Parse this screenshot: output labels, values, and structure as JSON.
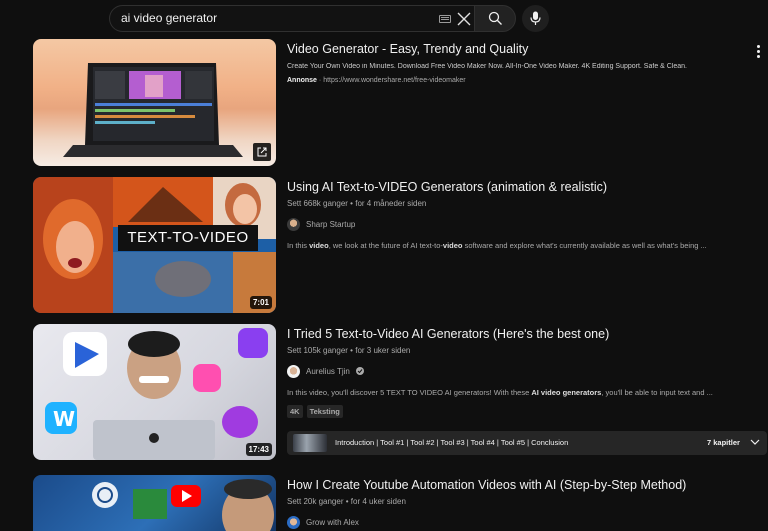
{
  "search": {
    "query": "ai video generator"
  },
  "results": [
    {
      "title": "Video Generator - Easy, Trendy and Quality",
      "description": "Create Your Own Video in Minutes. Download Free Video Maker Now. All-In-One Video Maker. 4K Editing Support. Safe & Clean.",
      "sponsor_label": "Annonse",
      "sponsor_sep": "·",
      "sponsor_url": "https://www.wondershare.net/free-videomaker"
    },
    {
      "title": "Using AI Text-to-VIDEO Generators (animation & realistic)",
      "views": "Sett 668k ganger",
      "age": "for 4 måneder siden",
      "channel": "Sharp Startup",
      "duration": "7:01",
      "thumb_text": "TEXT-TO-VIDEO",
      "desc_a": "In this ",
      "desc_b": "video",
      "desc_c": ", we look at the future of AI text-to-",
      "desc_d": "video",
      "desc_e": " software and explore what's currently available as well as what's being ..."
    },
    {
      "title": "I Tried 5 Text-to-Video AI Generators (Here's the best one)",
      "views": "Sett 105k ganger",
      "age": "for 3 uker siden",
      "channel": "Aurelius Tjin",
      "duration": "17:43",
      "desc_a": "In this video, you'll discover 5 TEXT TO VIDEO AI generators! With these ",
      "desc_b": "AI video generators",
      "desc_c": ", you'll be able to input text and ...",
      "badges": [
        "4K",
        "Teksting"
      ],
      "chapters_text": "Introduction | Tool #1 | Tool #2 | Tool #3 | Tool #4 | Tool #5 | Conclusion",
      "chapters_count": "7 kapitler"
    },
    {
      "title": "How I Create Youtube Automation Videos with AI (Step-by-Step Method)",
      "views": "Sett 20k ganger",
      "age": "for 4 uker siden",
      "channel": "Grow with Alex"
    }
  ],
  "meta_sep": "•",
  "colors": {
    "background": "#0f0f0f",
    "text": "#f1f1f1",
    "secondary": "#aaaaaa"
  }
}
